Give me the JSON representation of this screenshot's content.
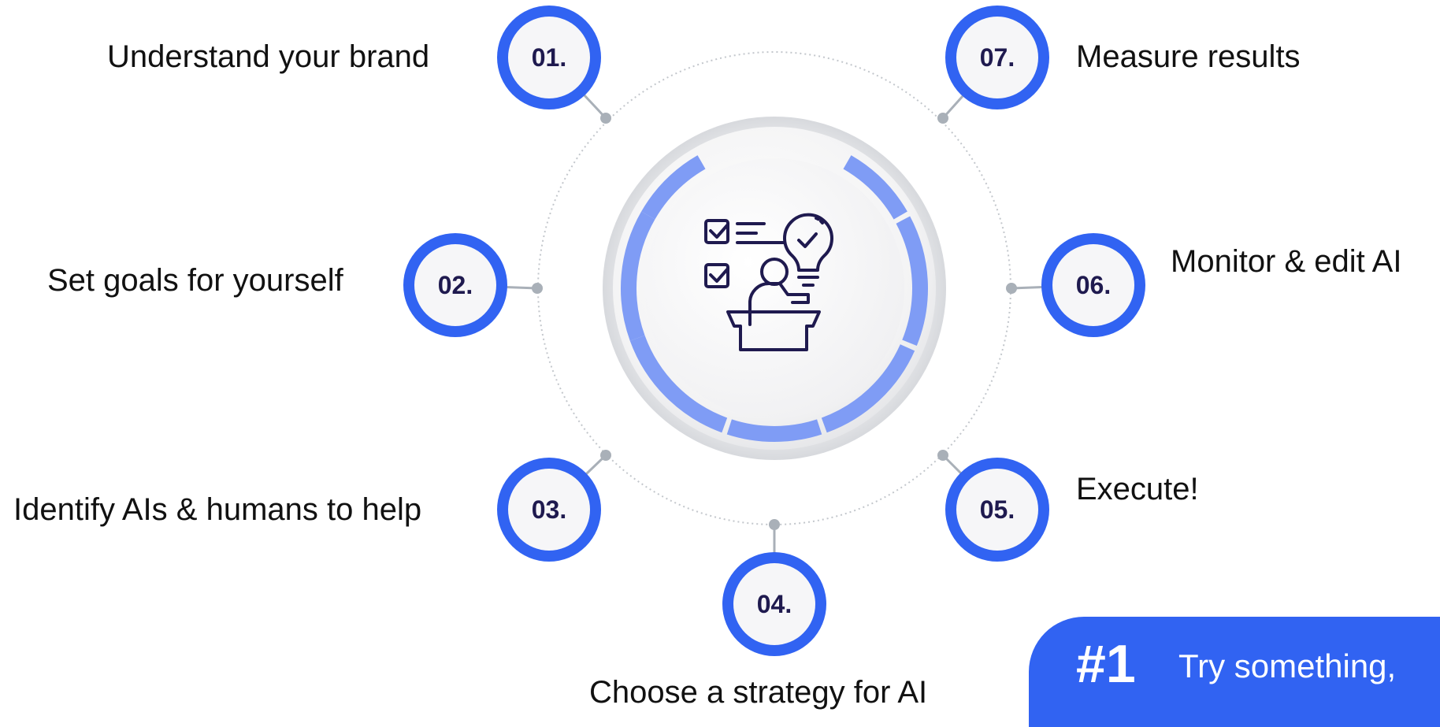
{
  "steps": [
    {
      "num": "01.",
      "label": "Understand your brand"
    },
    {
      "num": "02.",
      "label": "Set goals for yourself"
    },
    {
      "num": "03.",
      "label": "Identify AIs & humans to help"
    },
    {
      "num": "04.",
      "label": "Choose a strategy for AI"
    },
    {
      "num": "05.",
      "label": "Execute!"
    },
    {
      "num": "06.",
      "label": "Monitor & edit AI"
    },
    {
      "num": "07.",
      "label": "Measure results"
    }
  ],
  "tip": {
    "rank": "#1",
    "text": "Try something,"
  },
  "colors": {
    "accent": "#3163f2",
    "arc": "#7f9cf5",
    "number_text": "#1f1a4f",
    "icon": "#1f1a4f",
    "connector": "#a9b0b8"
  },
  "center_icon": "presentation-checklist-idea-icon"
}
